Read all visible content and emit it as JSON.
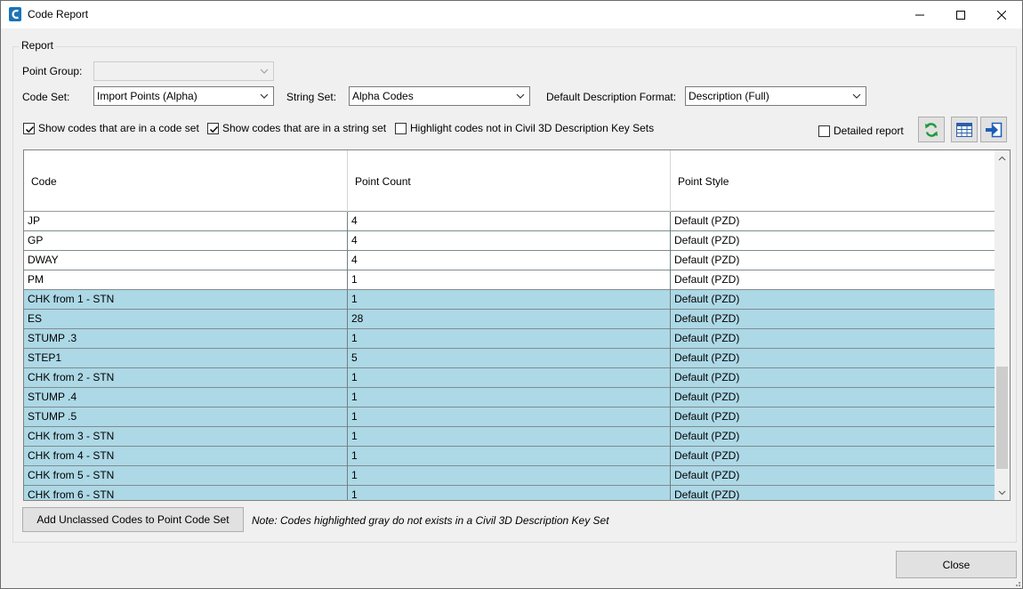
{
  "window": {
    "title": "Code Report",
    "icon": "civil3d-app-icon"
  },
  "report": {
    "group_label": "Report",
    "point_group_label": "Point Group:",
    "point_group_value": "",
    "code_set_label": "Code Set:",
    "code_set_value": "Import Points (Alpha)",
    "string_set_label": "String Set:",
    "string_set_value": "Alpha Codes",
    "desc_format_label": "Default Description Format:",
    "desc_format_value": "Description (Full)"
  },
  "options": {
    "show_code_set": {
      "label": "Show codes that are in a code set",
      "checked": true
    },
    "show_string_set": {
      "label": "Show codes that are in a string set",
      "checked": true
    },
    "highlight_not_in_keysets": {
      "label": "Highlight codes not in Civil 3D Description Key Sets",
      "checked": false
    },
    "detailed_report": {
      "label": "Detailed report",
      "checked": false
    }
  },
  "toolbar": {
    "refresh_icon": "refresh-icon",
    "table_icon": "table-icon",
    "export_icon": "export-icon"
  },
  "table": {
    "columns": [
      "Code",
      "Point Count",
      "Point Style"
    ],
    "rows": [
      {
        "code": "JP",
        "count": "4",
        "style": "Default (PZD)",
        "highlighted": false
      },
      {
        "code": "GP",
        "count": "4",
        "style": "Default (PZD)",
        "highlighted": false
      },
      {
        "code": "DWAY",
        "count": "4",
        "style": "Default (PZD)",
        "highlighted": false
      },
      {
        "code": "PM",
        "count": "1",
        "style": "Default (PZD)",
        "highlighted": false
      },
      {
        "code": "CHK from 1 - STN",
        "count": "1",
        "style": "Default (PZD)",
        "highlighted": true
      },
      {
        "code": "ES",
        "count": "28",
        "style": "Default (PZD)",
        "highlighted": true
      },
      {
        "code": "STUMP .3",
        "count": "1",
        "style": "Default (PZD)",
        "highlighted": true
      },
      {
        "code": "STEP1",
        "count": "5",
        "style": "Default (PZD)",
        "highlighted": true
      },
      {
        "code": "CHK from 2 - STN",
        "count": "1",
        "style": "Default (PZD)",
        "highlighted": true
      },
      {
        "code": "STUMP .4",
        "count": "1",
        "style": "Default (PZD)",
        "highlighted": true
      },
      {
        "code": "STUMP .5",
        "count": "1",
        "style": "Default (PZD)",
        "highlighted": true
      },
      {
        "code": "CHK from 3 - STN",
        "count": "1",
        "style": "Default (PZD)",
        "highlighted": true
      },
      {
        "code": "CHK from 4 - STN",
        "count": "1",
        "style": "Default (PZD)",
        "highlighted": true
      },
      {
        "code": "CHK from 5 - STN",
        "count": "1",
        "style": "Default (PZD)",
        "highlighted": true
      },
      {
        "code": "CHK from 6 - STN",
        "count": "1",
        "style": "Default (PZD)",
        "highlighted": true
      }
    ]
  },
  "footer": {
    "add_unclassed_label": "Add Unclassed Codes to Point Code Set",
    "note": "Note: Codes highlighted gray do not exists in a Civil 3D Description Key Set",
    "close_label": "Close"
  },
  "colors": {
    "highlight_row": "#add8e6",
    "refresh_green": "#1e9a3a",
    "export_blue": "#1d5fb8"
  }
}
